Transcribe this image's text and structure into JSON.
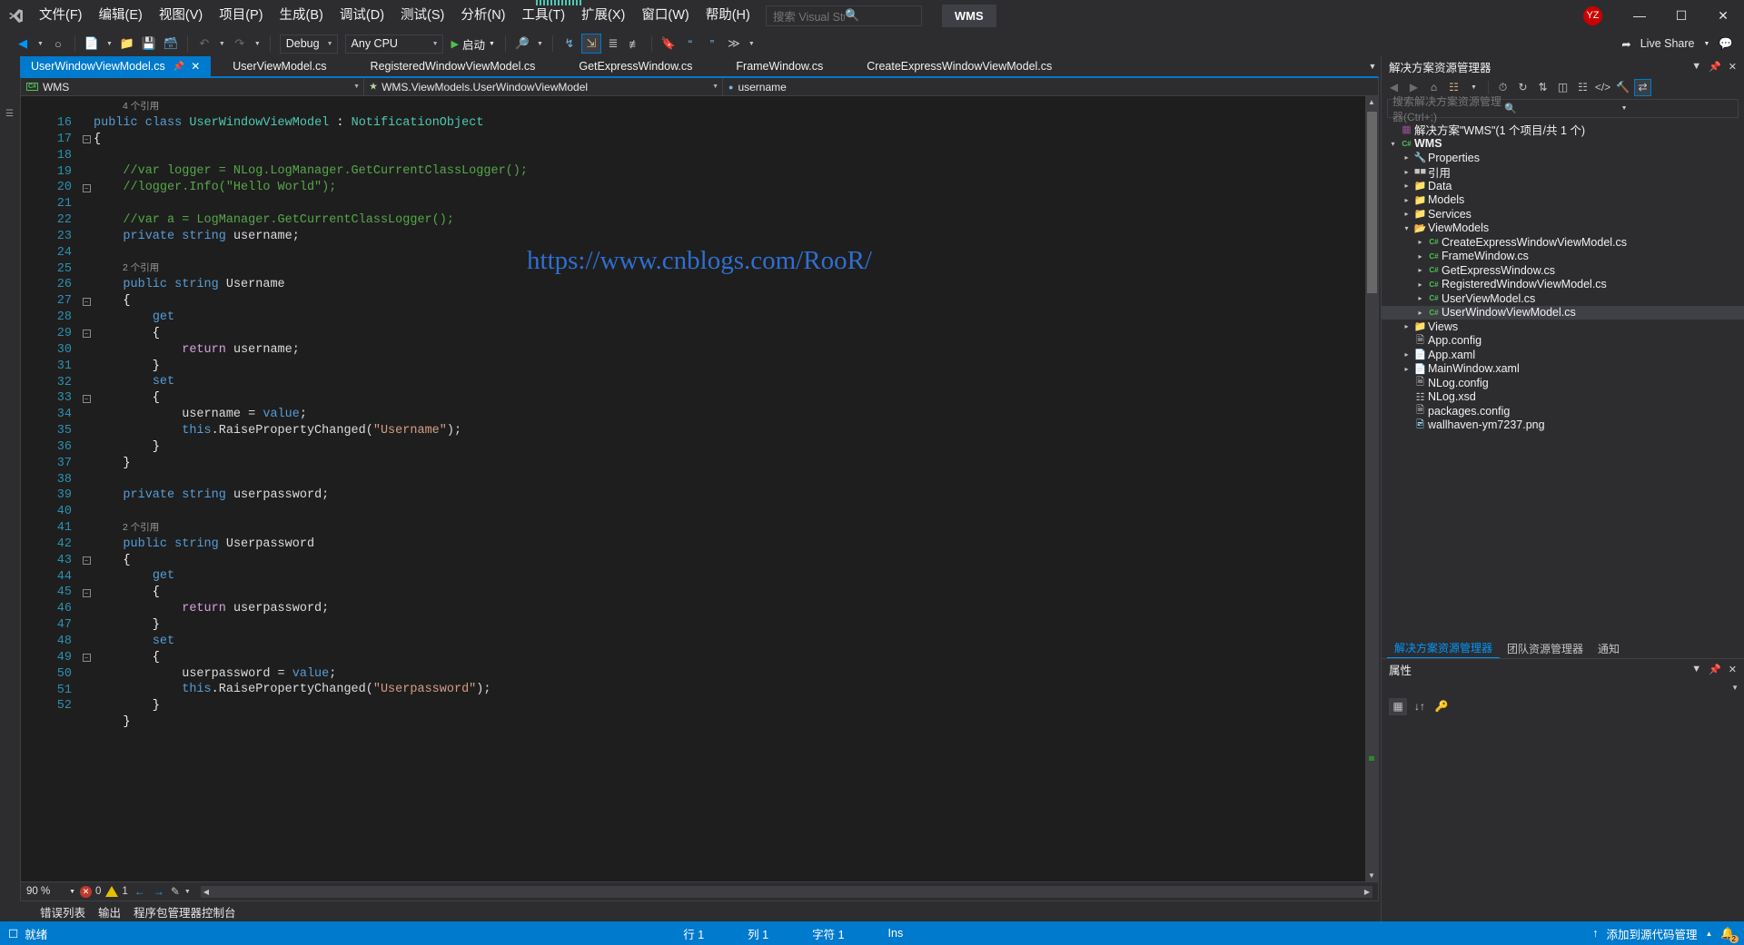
{
  "titlebar": {
    "logo_icon": "visual-studio-logo",
    "menus": [
      "文件(F)",
      "编辑(E)",
      "视图(V)",
      "项目(P)",
      "生成(B)",
      "调试(D)",
      "测试(S)",
      "分析(N)",
      "工具(T)",
      "扩展(X)",
      "窗口(W)",
      "帮助(H)"
    ],
    "search_placeholder": "搜索 Visual Studio (Ctrl+Q)",
    "search_icon": "search-icon",
    "project_chip": "WMS",
    "avatar_initials": "YZ",
    "minimize_icon": "minimize-icon",
    "maximize_icon": "maximize-icon",
    "close_icon": "close-icon",
    "avatar_color": "#cc0000"
  },
  "toolbar": {
    "back_icon": "navigate-back-icon",
    "forward_icon": "navigate-forward-icon",
    "new_icon": "new-file-icon",
    "open_icon": "open-file-icon",
    "save_icon": "save-icon",
    "save_all_icon": "save-all-icon",
    "undo_icon": "undo-icon",
    "redo_icon": "redo-icon",
    "config": "Debug",
    "platform": "Any CPU",
    "start_label": "启动",
    "start_icon": "play-icon",
    "find_icon": "find-icon",
    "step_icons": [
      "step-into-icon",
      "step-over-icon",
      "indent-icon",
      "outdent-icon",
      "bookmark-icon",
      "comment-icon",
      "uncomment-icon",
      "more-icon"
    ],
    "live_share_label": "Live Share",
    "live_share_icon": "live-share-icon",
    "feedback_icon": "feedback-icon"
  },
  "editor": {
    "tabs": [
      {
        "label": "UserWindowViewModel.cs",
        "active": true
      },
      {
        "label": "UserViewModel.cs",
        "active": false
      },
      {
        "label": "RegisteredWindowViewModel.cs",
        "active": false
      },
      {
        "label": "GetExpressWindow.cs",
        "active": false
      },
      {
        "label": "FrameWindow.cs",
        "active": false
      },
      {
        "label": "CreateExpressWindowViewModel.cs",
        "active": false
      }
    ],
    "tab_pin_icon": "pin-icon",
    "tab_close_icon": "close-icon",
    "tab_overflow_icon": "chevron-down-icon",
    "nav_project": "WMS",
    "nav_project_icon": "csharp-project-icon",
    "nav_type": "WMS.ViewModels.UserWindowViewModel",
    "nav_type_icon": "class-icon",
    "nav_member": "username",
    "nav_member_icon": "field-icon",
    "watermark": "https://www.cnblogs.com/RooR/",
    "watermark_color": "#2f6fd0",
    "first_line": 16,
    "lines": [
      {
        "n": "",
        "ref": "4 个引用",
        "html": ""
      },
      {
        "n": "16",
        "fold": "minus",
        "html": "<span class=\"kw\">public</span> <span class=\"kw\">class</span> <span class=\"type\">UserWindowViewModel</span> : <span class=\"type\">NotificationObject</span>"
      },
      {
        "n": "17",
        "html": "{"
      },
      {
        "n": "18",
        "html": ""
      },
      {
        "n": "19",
        "fold": "minus",
        "html": "    <span class=\"cm\">//var logger = NLog.LogManager.GetCurrentClassLogger();</span>"
      },
      {
        "n": "20",
        "html": "    <span class=\"cm\">//logger.Info(\"Hello World\");</span>"
      },
      {
        "n": "21",
        "html": ""
      },
      {
        "n": "22",
        "html": "    <span class=\"cm\">//var a = LogManager.GetCurrentClassLogger();</span>"
      },
      {
        "n": "23",
        "html": "    <span class=\"kw\">private</span> <span class=\"kw\">string</span> <span class=\"pl\">username;</span>"
      },
      {
        "n": "24",
        "html": ""
      },
      {
        "n": "",
        "ref": "2 个引用",
        "html": ""
      },
      {
        "n": "25",
        "fold": "minus",
        "html": "    <span class=\"kw\">public</span> <span class=\"kw\">string</span> <span class=\"pl\">Username</span>"
      },
      {
        "n": "26",
        "html": "    {"
      },
      {
        "n": "27",
        "fold": "minus",
        "html": "        <span class=\"kw\">get</span>"
      },
      {
        "n": "28",
        "html": "        {"
      },
      {
        "n": "29",
        "html": "            <span class=\"ctl\">return</span> <span class=\"pl\">username;</span>"
      },
      {
        "n": "30",
        "html": "        }"
      },
      {
        "n": "31",
        "fold": "minus",
        "html": "        <span class=\"kw\">set</span>"
      },
      {
        "n": "32",
        "html": "        {"
      },
      {
        "n": "33",
        "html": "            <span class=\"pl\">username = </span><span class=\"kw\">value</span><span class=\"pl\">;</span>"
      },
      {
        "n": "34",
        "html": "            <span class=\"kw\">this</span><span class=\"pl\">.RaisePropertyChanged(</span><span class=\"str\">\"Username\"</span><span class=\"pl\">);</span>"
      },
      {
        "n": "35",
        "html": "        }"
      },
      {
        "n": "36",
        "html": "    }"
      },
      {
        "n": "37",
        "html": ""
      },
      {
        "n": "38",
        "html": "    <span class=\"kw\">private</span> <span class=\"kw\">string</span> <span class=\"pl\">userpassword;</span>"
      },
      {
        "n": "39",
        "html": ""
      },
      {
        "n": "",
        "ref": "2 个引用",
        "html": ""
      },
      {
        "n": "40",
        "fold": "minus",
        "html": "    <span class=\"kw\">public</span> <span class=\"kw\">string</span> <span class=\"pl\">Userpassword</span>"
      },
      {
        "n": "41",
        "html": "    {"
      },
      {
        "n": "42",
        "fold": "minus",
        "html": "        <span class=\"kw\">get</span>"
      },
      {
        "n": "43",
        "html": "        {"
      },
      {
        "n": "44",
        "html": "            <span class=\"ctl\">return</span> <span class=\"pl\">userpassword;</span>"
      },
      {
        "n": "45",
        "html": "        }"
      },
      {
        "n": "46",
        "fold": "minus",
        "html": "        <span class=\"kw\">set</span>"
      },
      {
        "n": "47",
        "html": "        {"
      },
      {
        "n": "48",
        "html": "            <span class=\"pl\">userpassword = </span><span class=\"kw\">value</span><span class=\"pl\">;</span>"
      },
      {
        "n": "49",
        "html": "            <span class=\"kw\">this</span><span class=\"pl\">.RaisePropertyChanged(</span><span class=\"str\">\"Userpassword\"</span><span class=\"pl\">);</span>"
      },
      {
        "n": "50",
        "html": "        }"
      },
      {
        "n": "51",
        "html": "    }"
      },
      {
        "n": "52",
        "html": ""
      }
    ]
  },
  "editor_status": {
    "zoom": "90 %",
    "error_count": "0",
    "warning_count": "1",
    "prev_icon": "arrow-left-icon",
    "next_icon": "arrow-right-icon",
    "pencil_icon": "edit-icon"
  },
  "bottom_tabs": [
    "错误列表",
    "输出",
    "程序包管理器控制台"
  ],
  "solution_explorer": {
    "title": "解决方案资源管理器",
    "search_placeholder": "搜索解决方案资源管理器(Ctrl+;)",
    "search_icon": "search-icon",
    "float_icon": "chevron-down-icon",
    "pin_icon": "pin-icon",
    "close_icon": "close-icon",
    "toolbar_icons": [
      "back-icon",
      "forward-icon",
      "home-icon",
      "switch-views-icon",
      "refresh-icon",
      "collapse-all-icon",
      "show-all-files-icon",
      "properties-icon",
      "view-code-icon",
      "view-designer-icon",
      "sync-icon"
    ],
    "tree": [
      {
        "depth": 0,
        "twisty": "none",
        "icon": "solution-icon",
        "label": "解决方案\"WMS\"(1 个项目/共 1 个)",
        "bold": false
      },
      {
        "depth": 0,
        "twisty": "open",
        "icon": "cs-project-icon",
        "label": "WMS",
        "bold": true
      },
      {
        "depth": 1,
        "twisty": "closed",
        "icon": "wrench-icon",
        "label": "Properties",
        "bold": false
      },
      {
        "depth": 1,
        "twisty": "closed",
        "icon": "reference-icon",
        "label": "引用",
        "bold": false
      },
      {
        "depth": 1,
        "twisty": "closed",
        "icon": "folder-icon",
        "label": "Data",
        "bold": false
      },
      {
        "depth": 1,
        "twisty": "closed",
        "icon": "folder-icon",
        "label": "Models",
        "bold": false
      },
      {
        "depth": 1,
        "twisty": "closed",
        "icon": "folder-icon",
        "label": "Services",
        "bold": false
      },
      {
        "depth": 1,
        "twisty": "open",
        "icon": "folder-open-icon",
        "label": "ViewModels",
        "bold": false
      },
      {
        "depth": 2,
        "twisty": "closed",
        "icon": "cs-file-icon",
        "label": "CreateExpressWindowViewModel.cs",
        "bold": false
      },
      {
        "depth": 2,
        "twisty": "closed",
        "icon": "cs-file-icon",
        "label": "FrameWindow.cs",
        "bold": false
      },
      {
        "depth": 2,
        "twisty": "closed",
        "icon": "cs-file-icon",
        "label": "GetExpressWindow.cs",
        "bold": false
      },
      {
        "depth": 2,
        "twisty": "closed",
        "icon": "cs-file-icon",
        "label": "RegisteredWindowViewModel.cs",
        "bold": false
      },
      {
        "depth": 2,
        "twisty": "closed",
        "icon": "cs-file-icon",
        "label": "UserViewModel.cs",
        "bold": false
      },
      {
        "depth": 2,
        "twisty": "closed",
        "icon": "cs-file-icon",
        "label": "UserWindowViewModel.cs",
        "bold": false,
        "selected": true
      },
      {
        "depth": 1,
        "twisty": "closed",
        "icon": "folder-icon",
        "label": "Views",
        "bold": false
      },
      {
        "depth": 1,
        "twisty": "none",
        "icon": "config-icon",
        "label": "App.config",
        "bold": false
      },
      {
        "depth": 1,
        "twisty": "closed",
        "icon": "xaml-icon",
        "label": "App.xaml",
        "bold": false
      },
      {
        "depth": 1,
        "twisty": "closed",
        "icon": "xaml-icon",
        "label": "MainWindow.xaml",
        "bold": false
      },
      {
        "depth": 1,
        "twisty": "none",
        "icon": "config-icon",
        "label": "NLog.config",
        "bold": false
      },
      {
        "depth": 1,
        "twisty": "none",
        "icon": "xsd-icon",
        "label": "NLog.xsd",
        "bold": false
      },
      {
        "depth": 1,
        "twisty": "none",
        "icon": "config-icon",
        "label": "packages.config",
        "bold": false
      },
      {
        "depth": 1,
        "twisty": "none",
        "icon": "image-icon",
        "label": "wallhaven-ym7237.png",
        "bold": false
      }
    ],
    "dock_tabs": [
      {
        "label": "解决方案资源管理器",
        "active": true
      },
      {
        "label": "团队资源管理器",
        "active": false
      },
      {
        "label": "通知",
        "active": false
      }
    ]
  },
  "properties_pane": {
    "title": "属性",
    "float_icon": "chevron-down-icon",
    "pin_icon": "pin-icon",
    "close_icon": "close-icon",
    "toolbar_icons": [
      "categorized-icon",
      "alphabetical-icon",
      "properties-icon"
    ]
  },
  "statusbar": {
    "ready_icon": "ready-icon",
    "ready": "就绪",
    "line_label": "行 1",
    "col_label": "列 1",
    "char_label": "字符 1",
    "insert_mode": "Ins",
    "source_control_icon": "upload-icon",
    "source_control": "添加到源代码管理",
    "source_control_caret": "chevron-up-icon",
    "bell_icon": "notification-bell-icon",
    "bell_count": "2",
    "bar_color": "#007acc"
  }
}
